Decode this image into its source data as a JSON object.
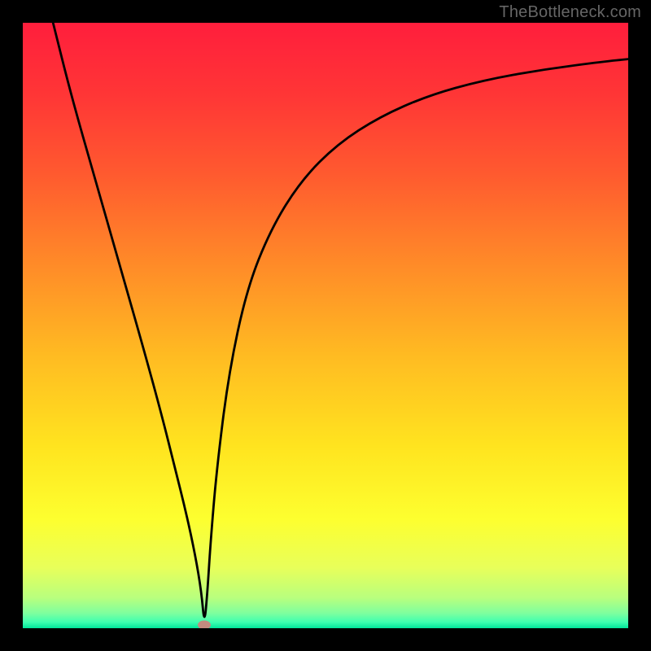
{
  "watermark": "TheBottleneck.com",
  "chart_data": {
    "type": "line",
    "title": "",
    "xlabel": "",
    "ylabel": "",
    "xlim": [
      0,
      100
    ],
    "ylim": [
      0,
      100
    ],
    "x": [
      5,
      8,
      12,
      16,
      20,
      23,
      25,
      27,
      28.5,
      29.5,
      30,
      30.5,
      31,
      32,
      34,
      37,
      41,
      46,
      52,
      59,
      67,
      76,
      86,
      96,
      100
    ],
    "values": [
      100,
      88,
      74,
      60,
      46,
      35,
      27,
      19,
      12,
      6,
      0.5,
      6,
      14,
      26,
      42,
      56,
      66,
      74,
      80,
      84.5,
      88,
      90.5,
      92.3,
      93.6,
      94
    ],
    "annotations": [
      {
        "type": "marker",
        "x": 30,
        "y": 0.5,
        "shape": "ellipse",
        "color": "#c48b7f"
      }
    ],
    "background": {
      "type": "vertical_gradient",
      "stops": [
        {
          "pos": 0.0,
          "color": "#ff1e3c"
        },
        {
          "pos": 0.12,
          "color": "#ff3636"
        },
        {
          "pos": 0.25,
          "color": "#ff5a2f"
        },
        {
          "pos": 0.4,
          "color": "#ff8b28"
        },
        {
          "pos": 0.55,
          "color": "#ffbb22"
        },
        {
          "pos": 0.7,
          "color": "#ffe41f"
        },
        {
          "pos": 0.82,
          "color": "#fdff2f"
        },
        {
          "pos": 0.9,
          "color": "#e8ff5a"
        },
        {
          "pos": 0.95,
          "color": "#b8ff7e"
        },
        {
          "pos": 0.975,
          "color": "#7fff9e"
        },
        {
          "pos": 0.99,
          "color": "#3effb0"
        },
        {
          "pos": 1.0,
          "color": "#00e59a"
        }
      ]
    }
  }
}
